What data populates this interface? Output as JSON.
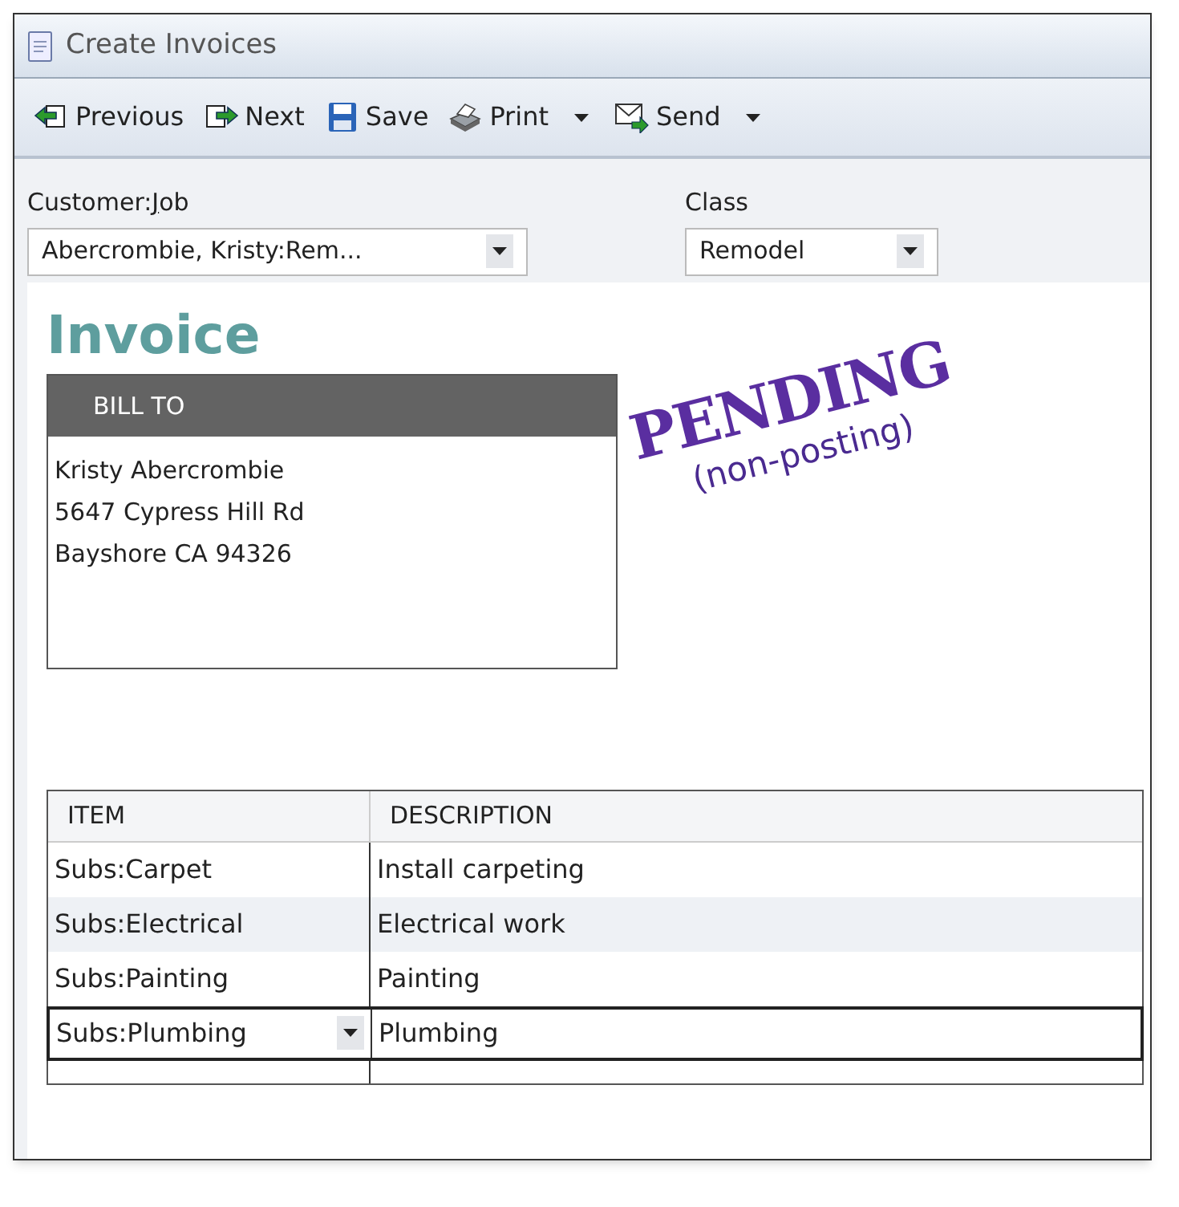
{
  "window": {
    "title": "Create Invoices"
  },
  "toolbar": [
    {
      "label": "Previous",
      "has_menu": false
    },
    {
      "label": "Next",
      "has_menu": false
    },
    {
      "label": "Save",
      "has_menu": false
    },
    {
      "label": "Print",
      "has_menu": true
    },
    {
      "label": "Send",
      "has_menu": true
    }
  ],
  "customer_job": {
    "label": "Customer:",
    "label_underlined": "J",
    "label_rest": "ob",
    "value": "Abercrombie, Kristy:Rem..."
  },
  "class": {
    "label": "Class",
    "value": "Remodel"
  },
  "form_title": "Invoice",
  "bill_to": {
    "heading": "BILL TO",
    "lines": [
      "Kristy Abercrombie",
      "5647 Cypress Hill Rd",
      "Bayshore CA 94326"
    ]
  },
  "stamp": {
    "title": "PENDING",
    "subtitle": "(non-posting)"
  },
  "table": {
    "columns": [
      "ITEM",
      "DESCRIPTION"
    ],
    "rows": [
      {
        "item": "Subs:Carpet",
        "description": "Install carpeting",
        "selected": false
      },
      {
        "item": "Subs:Electrical",
        "description": "Electrical work",
        "selected": false
      },
      {
        "item": "Subs:Painting",
        "description": "Painting",
        "selected": false
      },
      {
        "item": "Subs:Plumbing",
        "description": "Plumbing",
        "selected": true
      }
    ]
  }
}
